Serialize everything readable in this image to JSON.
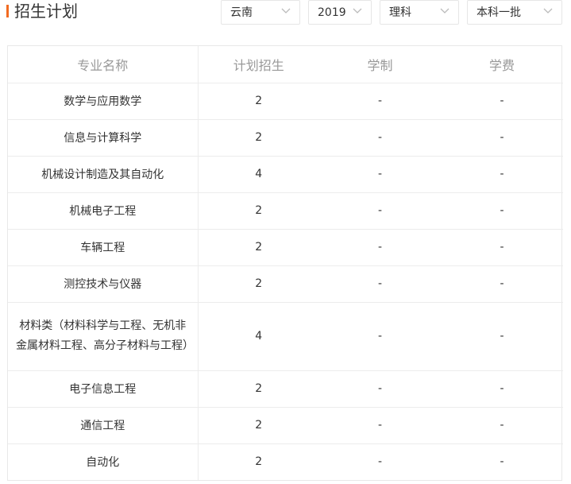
{
  "header": {
    "title": "招生计划",
    "filters": {
      "province": "云南",
      "year": "2019",
      "subject": "理科",
      "batch": "本科一批"
    }
  },
  "table": {
    "columns": [
      "专业名称",
      "计划招生",
      "学制",
      "学费"
    ],
    "rows": [
      {
        "major": "数学与应用数学",
        "plan": "2",
        "duration": "-",
        "fee": "-"
      },
      {
        "major": "信息与计算科学",
        "plan": "2",
        "duration": "-",
        "fee": "-"
      },
      {
        "major": "机械设计制造及其自动化",
        "plan": "4",
        "duration": "-",
        "fee": "-"
      },
      {
        "major": "机械电子工程",
        "plan": "2",
        "duration": "-",
        "fee": "-"
      },
      {
        "major": "车辆工程",
        "plan": "2",
        "duration": "-",
        "fee": "-"
      },
      {
        "major": "测控技术与仪器",
        "plan": "2",
        "duration": "-",
        "fee": "-"
      },
      {
        "major": "材料类（材料科学与工程、无机非金属材料工程、高分子材料与工程）",
        "plan": "4",
        "duration": "-",
        "fee": "-"
      },
      {
        "major": "电子信息工程",
        "plan": "2",
        "duration": "-",
        "fee": "-"
      },
      {
        "major": "通信工程",
        "plan": "2",
        "duration": "-",
        "fee": "-"
      },
      {
        "major": "自动化",
        "plan": "2",
        "duration": "-",
        "fee": "-"
      }
    ]
  },
  "icons": {
    "dropdown": "chevron-down-icon"
  },
  "colors": {
    "accent": "#f26b21",
    "header_text": "#999999",
    "border": "#ececec"
  }
}
